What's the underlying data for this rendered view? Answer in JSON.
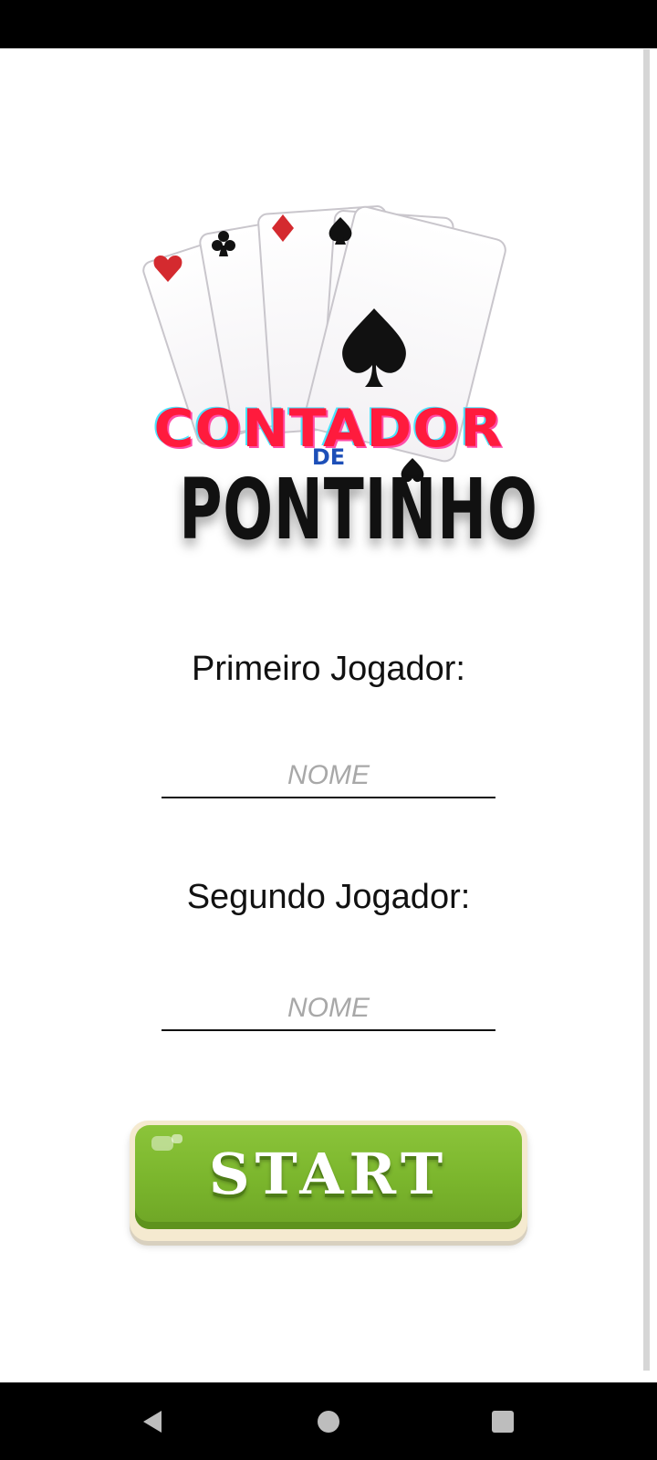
{
  "logo": {
    "line1": "CONTADOR",
    "line2": "DE",
    "line3": "PONTINHO",
    "suit_colors": {
      "red": "#d42a2f",
      "black": "#111111"
    }
  },
  "form": {
    "player1_label": "Primeiro Jogador:",
    "player1_placeholder": "NOME",
    "player2_label": "Segundo Jogador:",
    "player2_placeholder": "NOME"
  },
  "start_button": {
    "label": "START",
    "color": "#7ab52c"
  },
  "nav_bar": {
    "icons": [
      "back-icon",
      "home-icon",
      "recents-icon"
    ]
  }
}
